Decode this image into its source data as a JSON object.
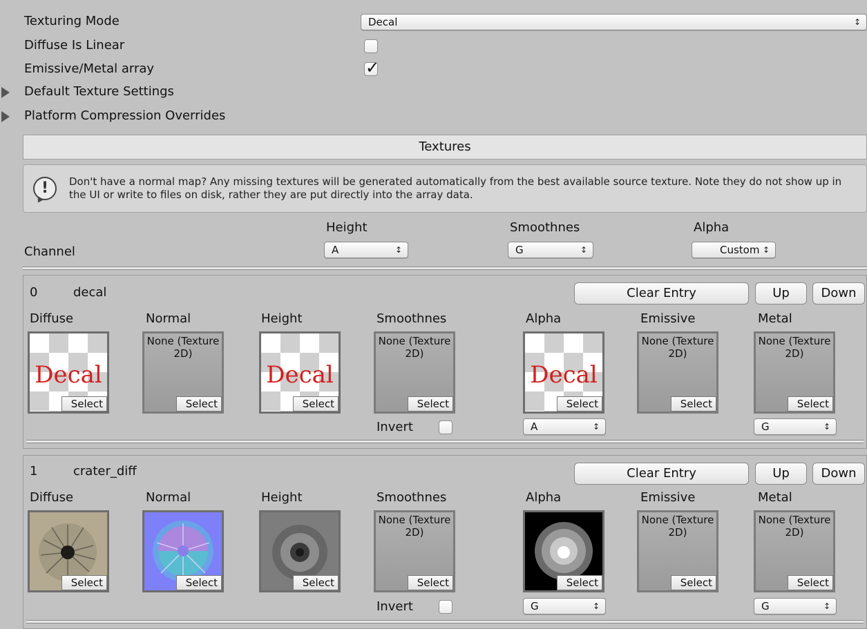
{
  "settings": {
    "texturing_mode_label": "Texturing Mode",
    "texturing_mode_value": "Decal",
    "diffuse_linear_label": "Diffuse Is Linear",
    "diffuse_linear_checked": false,
    "emissive_metal_label": "Emissive/Metal array",
    "emissive_metal_checked": true,
    "default_texture_settings_label": "Default Texture Settings",
    "platform_overrides_label": "Platform Compression Overrides"
  },
  "textures_header": "Textures",
  "help_text": "Don't have a normal map? Any missing textures will be generated automatically from the best available source texture. Note they do not show up in the UI or write to files on disk, rather they are put directly into the array data.",
  "channel_row": {
    "label": "Channel",
    "columns": [
      {
        "header": "Height",
        "value": "A"
      },
      {
        "header": "Smoothnes",
        "value": "G"
      },
      {
        "header": "Alpha",
        "value": "Custom"
      }
    ]
  },
  "entry_buttons": {
    "clear": "Clear Entry",
    "up": "Up",
    "down": "Down"
  },
  "slot_labels": [
    "Diffuse",
    "Normal",
    "Height",
    "Smoothnes",
    "Alpha",
    "Emissive",
    "Metal"
  ],
  "none_texture_text": "None (Texture 2D)",
  "select_label": "Select",
  "invert_label": "Invert",
  "decal_text": "Decal",
  "arrow_glyph": "↕",
  "entries": [
    {
      "index": "0",
      "name": "decal",
      "alpha_channel": "A",
      "metal_channel": "G",
      "invert_checked": false
    },
    {
      "index": "1",
      "name": "crater_diff",
      "alpha_channel": "G",
      "metal_channel": "G",
      "invert_checked": false
    }
  ],
  "icons": {
    "foldout": "triangle-right-icon",
    "help": "info-icon",
    "popup_arrows": "updown-arrows-icon",
    "checkmark": "checkmark-icon"
  },
  "colors": {
    "background": "#c2c2c2",
    "decal_red": "#d32020",
    "normal_blue": "#7d80f8"
  }
}
